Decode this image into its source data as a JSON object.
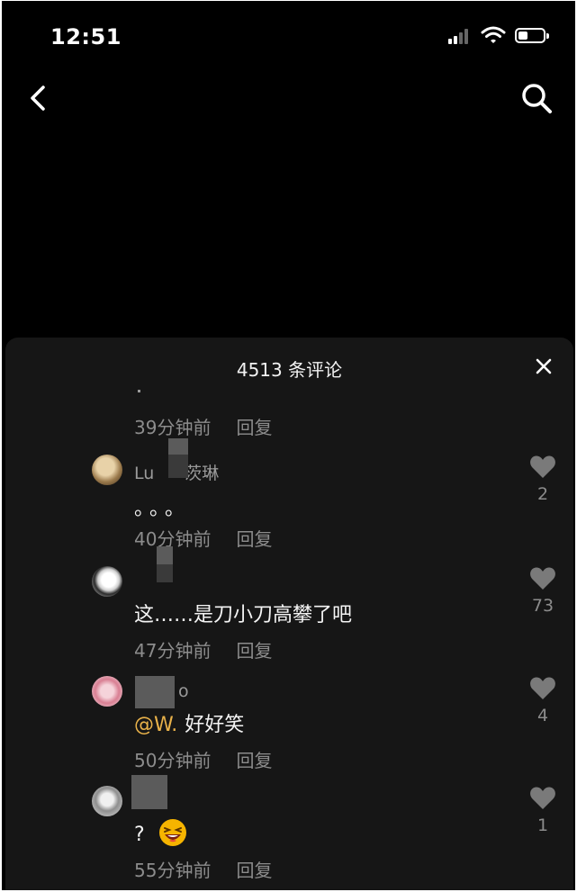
{
  "status_bar": {
    "time": "12:51"
  },
  "header": {
    "back_icon": "chevron-left-icon",
    "search_icon": "search-icon"
  },
  "sheet": {
    "title": "4513 条评论",
    "close_icon": "close-icon",
    "top_meta": {
      "time": "39分钟前",
      "reply": "回复"
    },
    "comments": [
      {
        "username_prefix": "Lu",
        "username_suffix": "茨琳",
        "text": "。。。",
        "time": "40分钟前",
        "reply": "回复",
        "likes": "2",
        "heart_icon": "heart-icon"
      },
      {
        "username": "",
        "text": "这……是刀小刀高攀了吧",
        "time": "47分钟前",
        "reply": "回复",
        "likes": "73",
        "heart_icon": "heart-icon"
      },
      {
        "username_suffix": "o",
        "mention": "@W.",
        "text": "好好笑",
        "time": "50分钟前",
        "reply": "回复",
        "likes": "4",
        "heart_icon": "heart-icon"
      },
      {
        "username": "",
        "text": "?",
        "emoji": "laughing-emoji",
        "time": "55分钟前",
        "reply": "回复",
        "likes": "1",
        "heart_icon": "heart-icon"
      }
    ]
  },
  "colors": {
    "background": "#000000",
    "sheet": "#161616",
    "mention": "#e9b24a",
    "meta": "#8c8c8c"
  }
}
